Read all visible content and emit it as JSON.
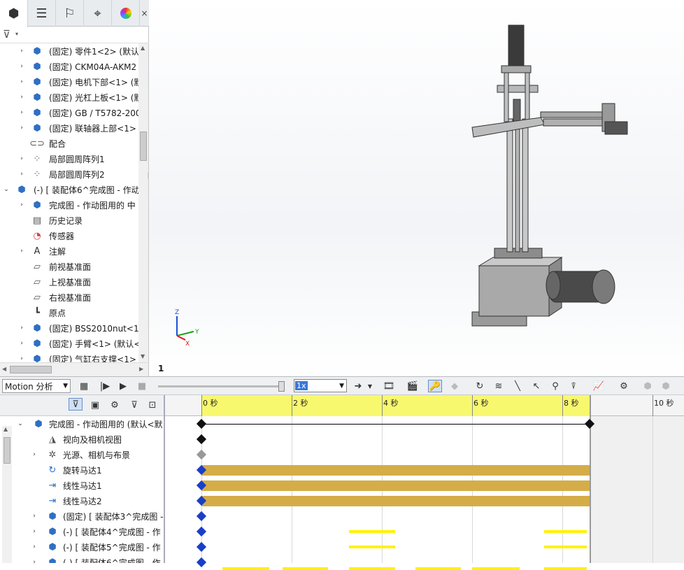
{
  "fm_tabs": [
    {
      "icon": "feature-manager-icon"
    },
    {
      "icon": "property-manager-icon"
    },
    {
      "icon": "configuration-manager-icon"
    },
    {
      "icon": "dimxpert-icon"
    },
    {
      "icon": "display-manager-icon"
    }
  ],
  "close_glyph": "×",
  "tree": [
    {
      "label": "(固定) 零件1<2> (默认",
      "icon": "part-icon",
      "arrow": "›",
      "indent": 1
    },
    {
      "label": "(固定) CKM04A-AKM2",
      "icon": "part-icon",
      "arrow": "›",
      "indent": 1
    },
    {
      "label": "(固定) 电机下部<1> (默",
      "icon": "part-icon",
      "arrow": "›",
      "indent": 1
    },
    {
      "label": "(固定) 光杠上板<1> (默",
      "icon": "part-icon",
      "arrow": "›",
      "indent": 1
    },
    {
      "label": "(固定) GB / T5782-200",
      "icon": "part-icon",
      "arrow": "›",
      "indent": 1
    },
    {
      "label": "(固定) 联轴器上部<1>",
      "icon": "part-icon",
      "arrow": "›",
      "indent": 1
    },
    {
      "label": "配合",
      "icon": "mates-icon",
      "arrow": "",
      "indent": 1
    },
    {
      "label": "局部圆周阵列1",
      "icon": "pattern-icon",
      "arrow": "›",
      "indent": 1
    },
    {
      "label": "局部圆周阵列2",
      "icon": "pattern-icon",
      "arrow": "›",
      "indent": 1
    },
    {
      "label": "(-) [ 装配体6^完成图 - 作动",
      "icon": "assembly-icon",
      "arrow": "⌄",
      "indent": 0
    },
    {
      "label": "完成图 - 作动图用的 中",
      "icon": "assembly-icon",
      "arrow": "›",
      "indent": 1
    },
    {
      "label": "历史记录",
      "icon": "history-icon",
      "arrow": "",
      "indent": 1
    },
    {
      "label": "传感器",
      "icon": "sensor-icon",
      "arrow": "",
      "indent": 1
    },
    {
      "label": "注解",
      "icon": "annotation-icon",
      "arrow": "›",
      "indent": 1
    },
    {
      "label": "前视基准面",
      "icon": "plane-icon",
      "arrow": "",
      "indent": 1
    },
    {
      "label": "上视基准面",
      "icon": "plane-icon",
      "arrow": "",
      "indent": 1
    },
    {
      "label": "右视基准面",
      "icon": "plane-icon",
      "arrow": "",
      "indent": 1
    },
    {
      "label": "原点",
      "icon": "origin-icon",
      "arrow": "",
      "indent": 1
    },
    {
      "label": "(固定) BSS2010nut<1>",
      "icon": "part-icon",
      "arrow": "›",
      "indent": 1
    },
    {
      "label": "(固定) 手臂<1> (默认<",
      "icon": "part-icon",
      "arrow": "›",
      "indent": 1
    },
    {
      "label": "(固定) 气缸右支撑<1>",
      "icon": "part-icon",
      "arrow": "›",
      "indent": 1
    }
  ],
  "viewport": {
    "page_number": "1",
    "axes": {
      "x": "X",
      "y": "Y",
      "z": "Z"
    }
  },
  "motion": {
    "study_type": "Motion 分析",
    "playback_speed": "1x",
    "ruler": [
      "0 秒",
      "2 秒",
      "4 秒",
      "6 秒",
      "8 秒",
      "10 秒"
    ],
    "timeline_end_seconds": 8.6,
    "tree": [
      {
        "label": "完成图 - 作动图用的 (默认<默",
        "icon": "assembly-icon",
        "arrow": "⌄"
      },
      {
        "label": "视向及相机视图",
        "icon": "camera-icon",
        "arrow": ""
      },
      {
        "label": "光源、相机与布景",
        "icon": "lights-icon",
        "arrow": "›"
      },
      {
        "label": "旋转马达1",
        "icon": "rotary-motor-icon",
        "arrow": ""
      },
      {
        "label": "线性马达1",
        "icon": "linear-motor-icon",
        "arrow": ""
      },
      {
        "label": "线性马达2",
        "icon": "linear-motor-icon",
        "arrow": ""
      },
      {
        "label": "(固定) [ 装配体3^完成图 -",
        "icon": "assembly-icon",
        "arrow": "›"
      },
      {
        "label": "(-) [ 装配体4^完成图 - 作",
        "icon": "assembly-icon",
        "arrow": "›"
      },
      {
        "label": "(-) [ 装配体5^完成图 - 作",
        "icon": "assembly-icon",
        "arrow": "›"
      },
      {
        "label": "(-) [ 装配体6^完成图 - 作",
        "icon": "assembly-icon",
        "arrow": "›"
      }
    ]
  }
}
